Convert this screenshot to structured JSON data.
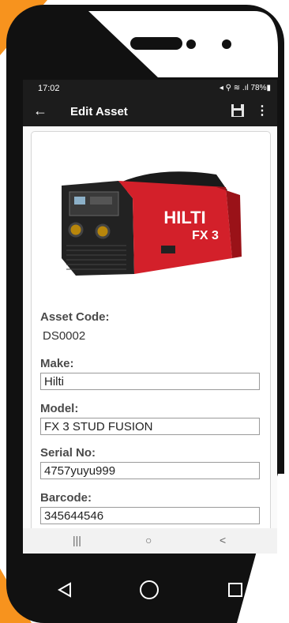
{
  "status_bar": {
    "time": "17:02",
    "icons": "◂ ⚲ ≋ .ıl 78%▮",
    "battery": "78%"
  },
  "app_bar": {
    "title": "Edit Asset",
    "back_icon": "arrow-left-icon",
    "save_icon": "floppy-disk-icon",
    "more_icon": "more-vertical-icon"
  },
  "product": {
    "brand_text": "HILTI",
    "model_text": "FX 3"
  },
  "fields": [
    {
      "label": "Asset Code:",
      "value": "DS0002",
      "type": "text"
    },
    {
      "label": "Make:",
      "value": "Hilti",
      "type": "input"
    },
    {
      "label": "Model:",
      "value": "FX 3 STUD FUSION",
      "type": "input"
    },
    {
      "label": "Serial No:",
      "value": "4757yuyu999",
      "type": "input"
    },
    {
      "label": "Barcode:",
      "value": "345644546",
      "type": "input"
    }
  ],
  "android_nav": {
    "recents": "|||",
    "home": "○",
    "back": "<"
  },
  "colors": {
    "app_bar": "#1c1c1c",
    "accent_orange": "#f7931e",
    "hilti_red": "#d3202a",
    "phone_frame": "#111111"
  }
}
